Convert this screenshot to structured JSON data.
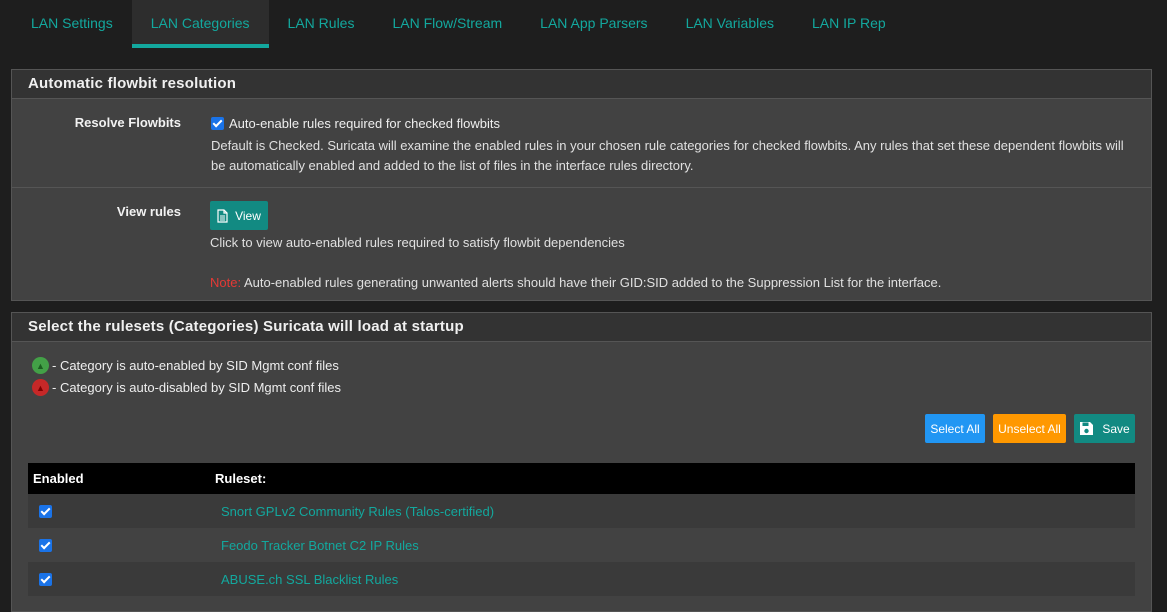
{
  "tabs": [
    {
      "label": "LAN Settings"
    },
    {
      "label": "LAN Categories",
      "active": true
    },
    {
      "label": "LAN Rules"
    },
    {
      "label": "LAN Flow/Stream"
    },
    {
      "label": "LAN App Parsers"
    },
    {
      "label": "LAN Variables"
    },
    {
      "label": "LAN IP Rep"
    }
  ],
  "flowbit_panel": {
    "heading": "Automatic flowbit resolution",
    "resolve": {
      "label": "Resolve Flowbits",
      "checkbox_label": "Auto-enable rules required for checked flowbits",
      "checked": true,
      "help": "Default is Checked. Suricata will examine the enabled rules in your chosen rule categories for checked flowbits. Any rules that set these dependent flowbits will be automatically enabled and added to the list of files in the interface rules directory."
    },
    "view": {
      "label": "View rules",
      "button_label": "View",
      "help": "Click to view auto-enabled rules required to satisfy flowbit dependencies",
      "note_label": "Note:",
      "note_text": " Auto-enabled rules generating unwanted alerts should have their GID:SID added to the Suppression List for the interface."
    }
  },
  "ruleset_panel": {
    "heading": "Select the rulesets (Categories) Suricata will load at startup",
    "legend": {
      "enabled_text": "- Category is auto-enabled by SID Mgmt conf files",
      "disabled_text": "- Category is auto-disabled by SID Mgmt conf files"
    },
    "buttons": {
      "select_all": "Select All",
      "unselect_all": "Unselect All",
      "save": "Save"
    },
    "table": {
      "headers": {
        "enabled": "Enabled",
        "ruleset": "Ruleset:"
      },
      "rows": [
        {
          "enabled": true,
          "ruleset": "Snort GPLv2 Community Rules (Talos-certified)"
        },
        {
          "enabled": true,
          "ruleset": "Feodo Tracker Botnet C2 IP Rules"
        },
        {
          "enabled": true,
          "ruleset": "ABUSE.ch SSL Blacklist Rules"
        }
      ]
    }
  },
  "colors": {
    "accent": "#13a89e",
    "select_all": "#2196f3",
    "unselect_all": "#ff9800",
    "note": "#e53935"
  },
  "icons": {
    "view": "document-icon",
    "save": "floppy-disk-icon",
    "auto_enabled": "green-circle-icon",
    "auto_disabled": "red-circle-icon"
  }
}
